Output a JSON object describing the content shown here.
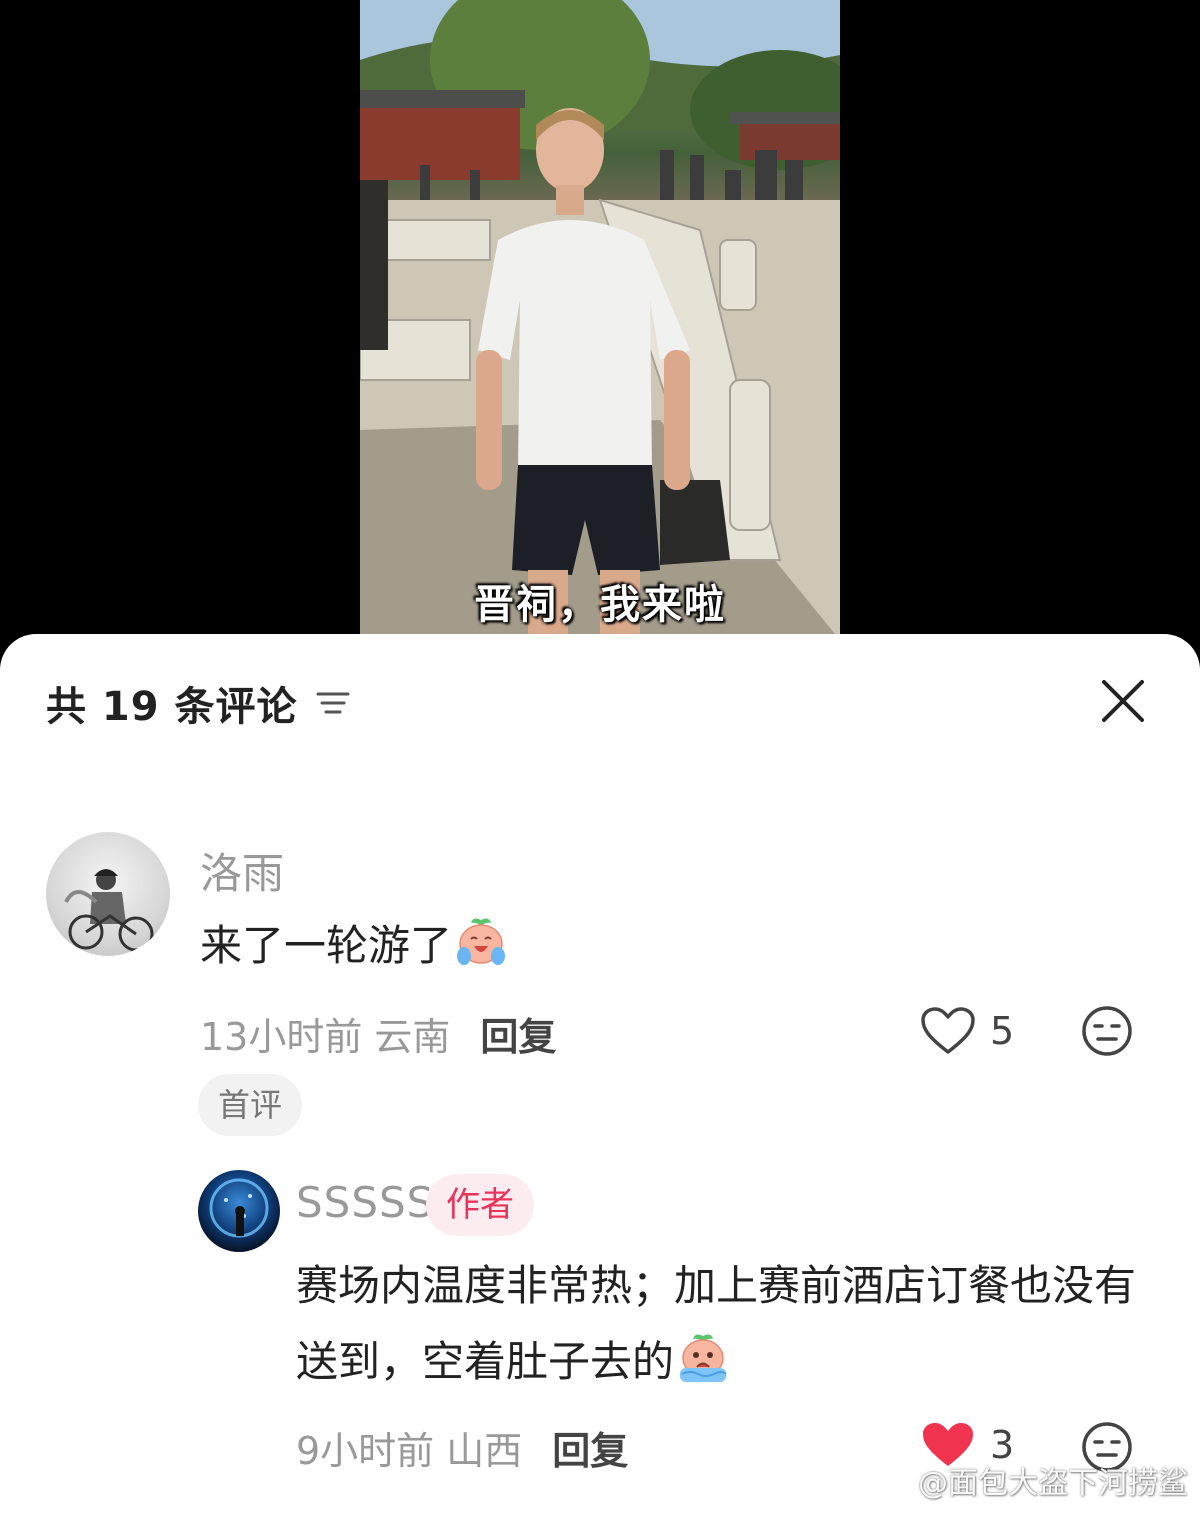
{
  "video": {
    "subtitle": "晋祠，我来啦"
  },
  "comments_panel": {
    "title": "共 19 条评论",
    "sort_icon": "sort-icon",
    "close_icon": "close-icon"
  },
  "comments": [
    {
      "username": "洛雨",
      "text": "来了一轮游了",
      "emoji": "crying-laughing-face-emoji",
      "time": "13小时前",
      "region": "云南",
      "reply_label": "回复",
      "likes": "5",
      "liked": false,
      "tag": "首评"
    },
    {
      "username": "SSSSS",
      "author_badge": "作者",
      "text": "赛场内温度非常热；加上赛前酒店订餐也没有送到，空着肚子去的",
      "emoji": "crying-face-emoji",
      "time": "9小时前",
      "region": "山西",
      "reply_label": "回复",
      "likes": "3",
      "liked": true
    }
  ],
  "colors": {
    "like_active": "#f0344f",
    "author_badge_bg": "#fdecef",
    "author_badge_text": "#e8335b",
    "muted_text": "#999999"
  },
  "watermark": "@面包大盗下河捞鲨"
}
